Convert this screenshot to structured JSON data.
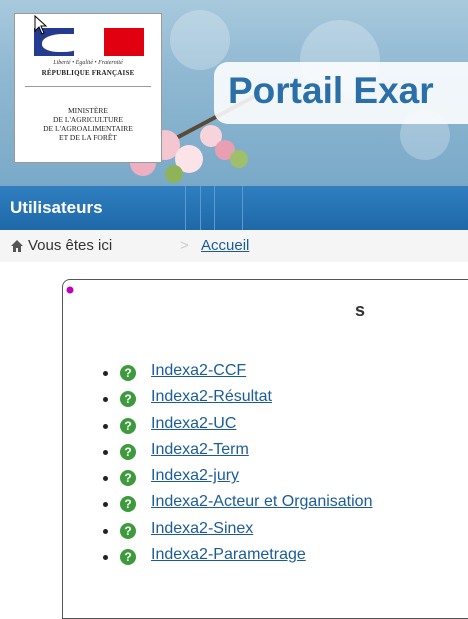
{
  "header": {
    "site_title": "Portail Exar",
    "logo": {
      "devise": "Liberté • Égalité • Fraternité",
      "republique": "RÉPUBLIQUE FRANÇAISE",
      "ministere_lines": [
        "MINISTÈRE",
        "DE L'AGRICULTURE",
        "DE L'AGROALIMENTAIRE",
        "ET DE LA FORÊT"
      ]
    }
  },
  "nav": {
    "items": [
      {
        "label": "Utilisateurs"
      }
    ]
  },
  "breadcrumb": {
    "prefix": "Vous êtes ici",
    "separator": ">",
    "home_link": "Accueil"
  },
  "panel": {
    "title": "s",
    "apps": [
      {
        "label": "Indexa2-CCF"
      },
      {
        "label": "Indexa2-Résultat"
      },
      {
        "label": "Indexa2-UC"
      },
      {
        "label": "Indexa2-Term"
      },
      {
        "label": "Indexa2-jury"
      },
      {
        "label": "Indexa2-Acteur et Organisation"
      },
      {
        "label": "Indexa2-Sinex"
      },
      {
        "label": "Indexa2-Parametrage"
      }
    ]
  },
  "colors": {
    "nav_blue": "#1f68a8",
    "link_blue": "#1a5c99",
    "help_green": "#3d9a3d",
    "title_blue": "#2a6fa8"
  }
}
